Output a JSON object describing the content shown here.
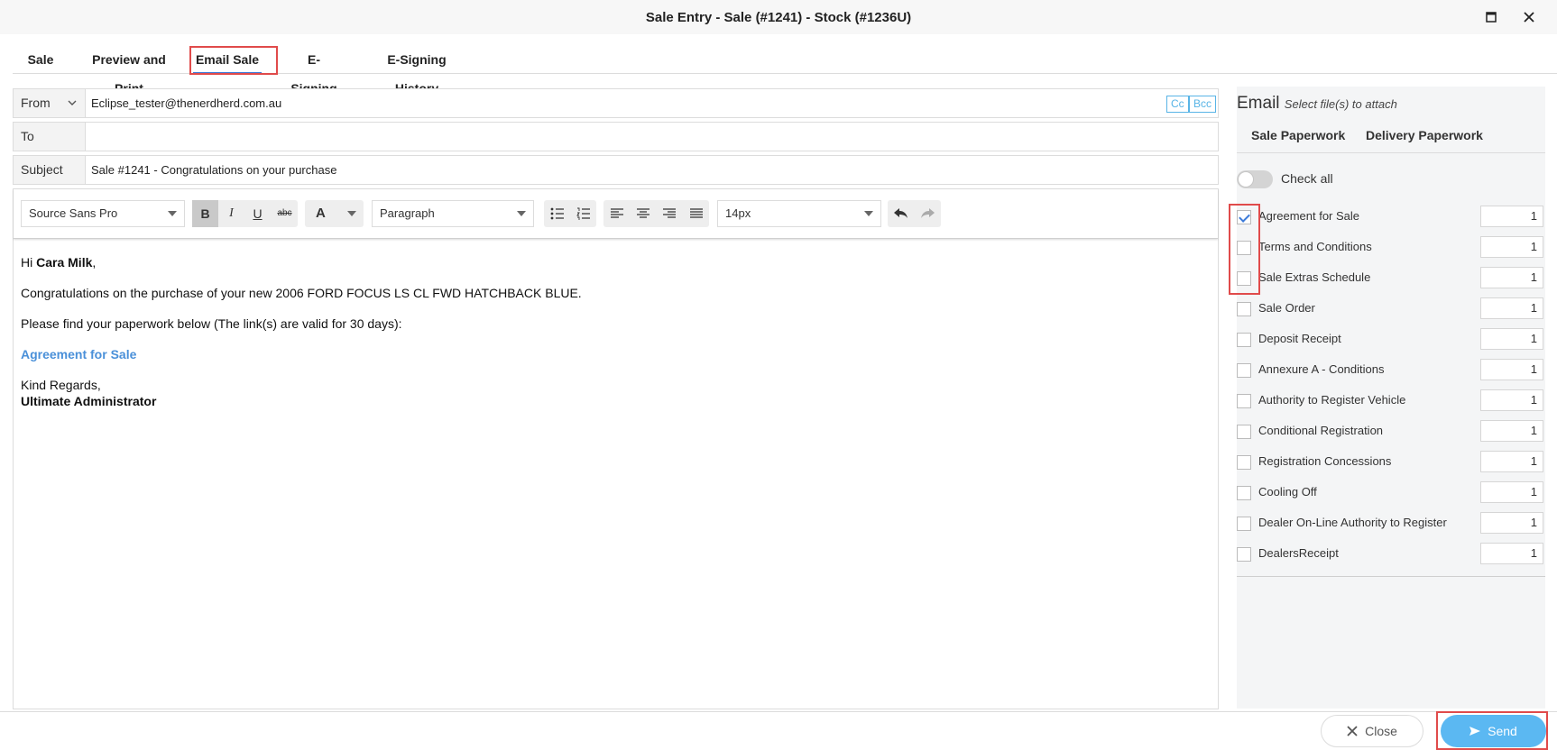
{
  "window": {
    "title": "Sale Entry - Sale (#1241) - Stock (#1236U)"
  },
  "tabs": [
    "Sale",
    "Preview and Print",
    "Email Sale",
    "E-Signing",
    "E-Signing History"
  ],
  "active_tab": "Email Sale",
  "form": {
    "from_label": "From",
    "from_value": "Eclipse_tester@thenerdherd.com.au",
    "cc_label": "Cc",
    "bcc_label": "Bcc",
    "to_label": "To",
    "to_value": "",
    "subject_label": "Subject",
    "subject_value": "Sale #1241 - Congratulations on your purchase"
  },
  "toolbar": {
    "font_family": "Source Sans Pro",
    "bold": "B",
    "italic": "I",
    "underline": "U",
    "strike": "abc",
    "font_color": "A",
    "block_format": "Paragraph",
    "font_size": "14px"
  },
  "body": {
    "greeting_prefix": "Hi ",
    "customer_name": "Cara Milk",
    "greeting_suffix": ",",
    "line1": "Congratulations on the purchase of your new 2006 FORD FOCUS LS CL FWD HATCHBACK BLUE.",
    "line2": "Please find your paperwork below (The link(s) are valid for 30 days):",
    "link": "Agreement for Sale",
    "signoff": "Kind Regards,",
    "signature": "Ultimate Administrator"
  },
  "panel": {
    "heading": "Email",
    "subheading": "Select file(s) to attach",
    "tabs": [
      "Sale Paperwork",
      "Delivery Paperwork"
    ],
    "check_all_label": "Check all",
    "check_all_on": false,
    "items": [
      {
        "label": "Agreement for Sale",
        "qty": "1",
        "checked": true
      },
      {
        "label": "Terms and Conditions",
        "qty": "1",
        "checked": false
      },
      {
        "label": "Sale Extras Schedule",
        "qty": "1",
        "checked": false
      },
      {
        "label": "Sale Order",
        "qty": "1",
        "checked": false
      },
      {
        "label": "Deposit Receipt",
        "qty": "1",
        "checked": false
      },
      {
        "label": "Annexure A - Conditions",
        "qty": "1",
        "checked": false
      },
      {
        "label": "Authority to Register Vehicle",
        "qty": "1",
        "checked": false
      },
      {
        "label": "Conditional Registration",
        "qty": "1",
        "checked": false
      },
      {
        "label": "Registration Concessions",
        "qty": "1",
        "checked": false
      },
      {
        "label": "Cooling Off",
        "qty": "1",
        "checked": false
      },
      {
        "label": "Dealer On-Line Authority to Register",
        "qty": "1",
        "checked": false
      },
      {
        "label": "DealersReceipt",
        "qty": "1",
        "checked": false
      }
    ]
  },
  "footer": {
    "close_label": "Close",
    "send_label": "Send"
  },
  "colors": {
    "accent": "#3d7bd9",
    "send": "#5bb8f2",
    "highlight": "#e04b4b",
    "link": "#4a90d9"
  }
}
